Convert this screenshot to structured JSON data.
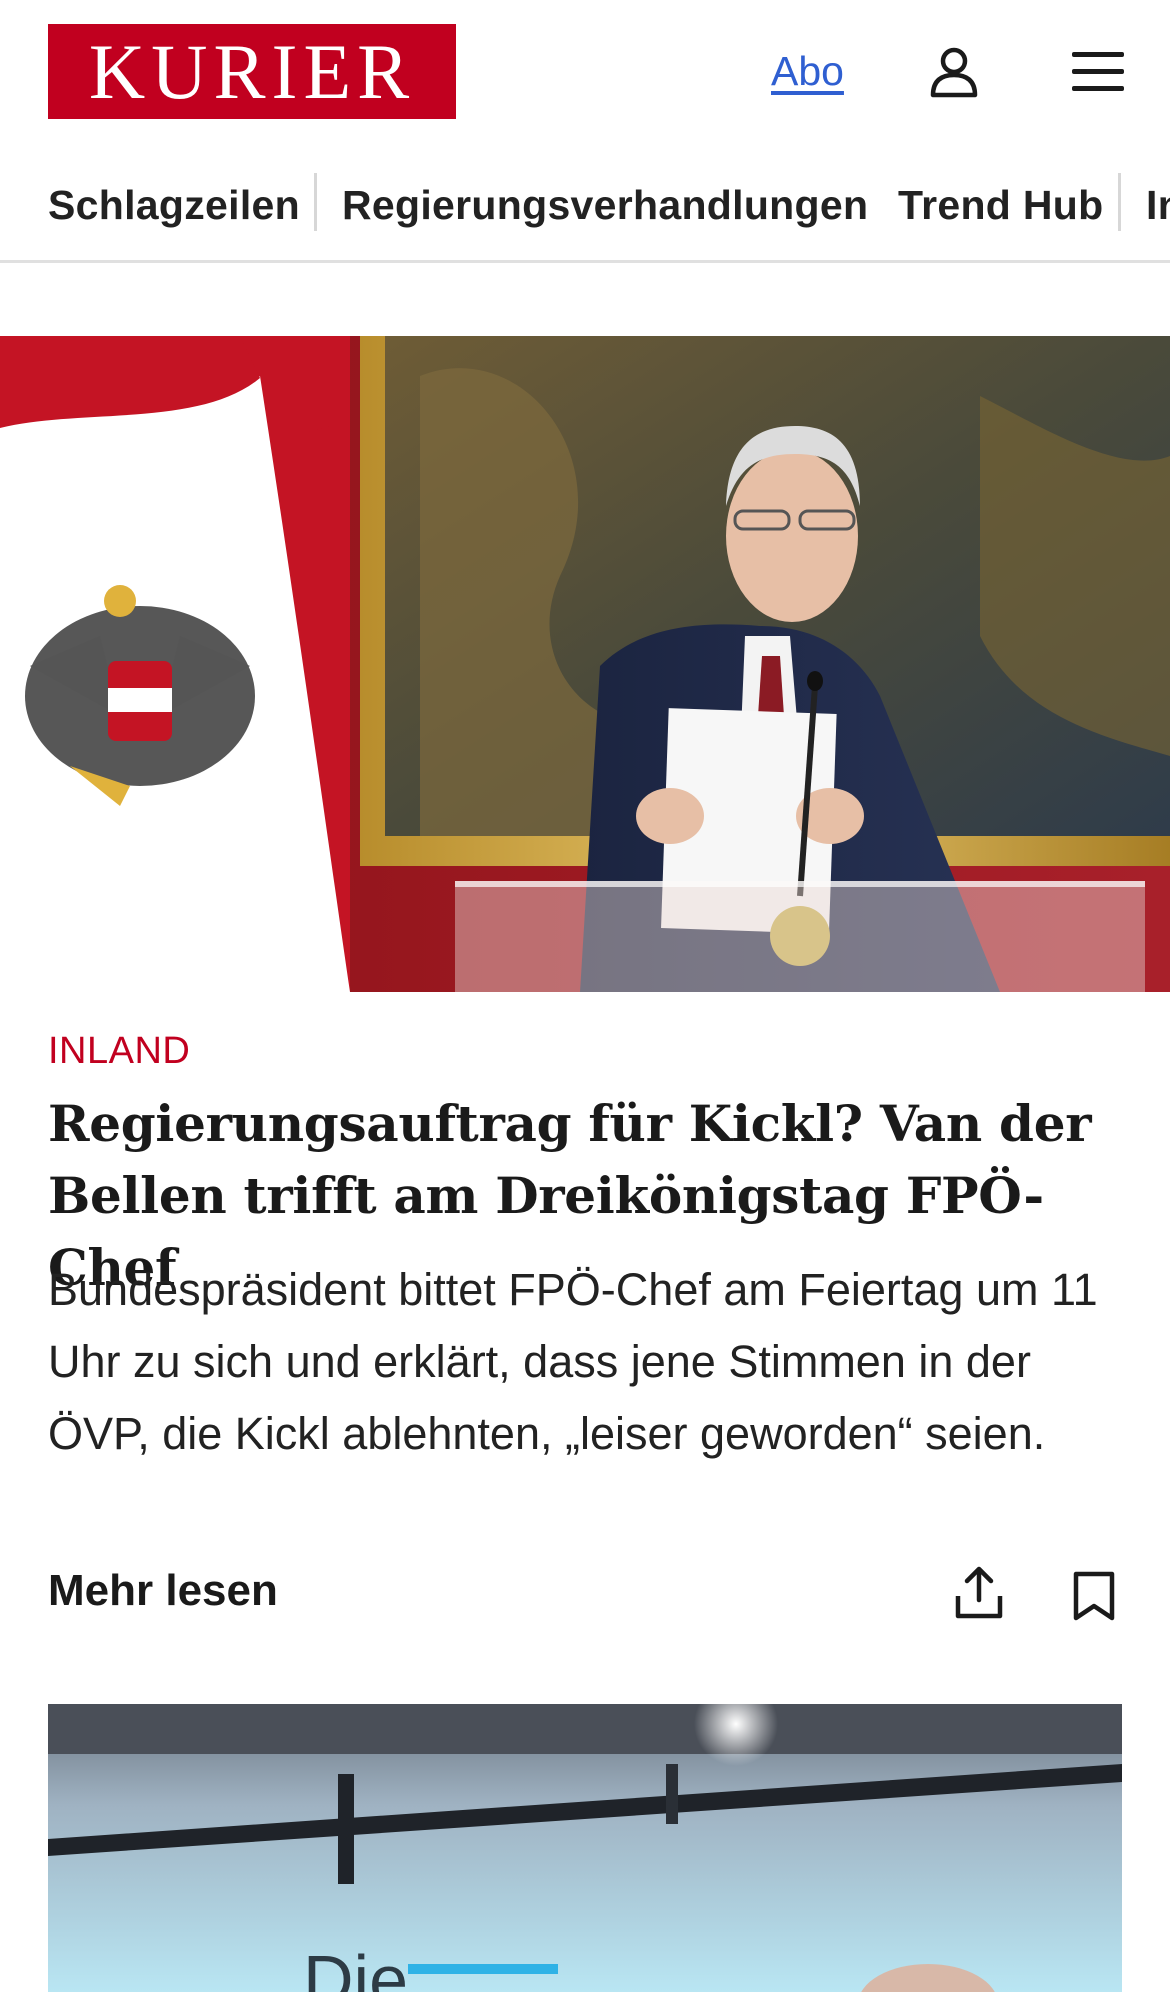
{
  "header": {
    "logo_text": "KURIER",
    "abo_label": "Abo",
    "brand_color": "#c1001f",
    "link_color": "#2f5fd1",
    "icons": [
      "user-icon",
      "menu-icon"
    ]
  },
  "nav": {
    "items": [
      {
        "label": "Schlagzeilen"
      },
      {
        "label": "Regierungsverhandlungen"
      },
      {
        "label": "Trend Hub"
      },
      {
        "label": "In"
      }
    ]
  },
  "article": {
    "category": "INLAND",
    "headline": "Regierungsauftrag für Kickl? Van der Bellen trifft am Dreikönigstag FPÖ-Chef",
    "teaser": "Bundespräsident bittet FPÖ-Chef am Feiertag um 11 Uhr zu sich und erklärt, dass jene Stimmen in der ÖVP, die Kickl ablehnten, „leiser geworden“ seien.",
    "more_label": "Mehr lesen",
    "icons": [
      "share-icon",
      "bookmark-icon"
    ]
  },
  "second_article": {
    "image_partial_text": "Die"
  }
}
